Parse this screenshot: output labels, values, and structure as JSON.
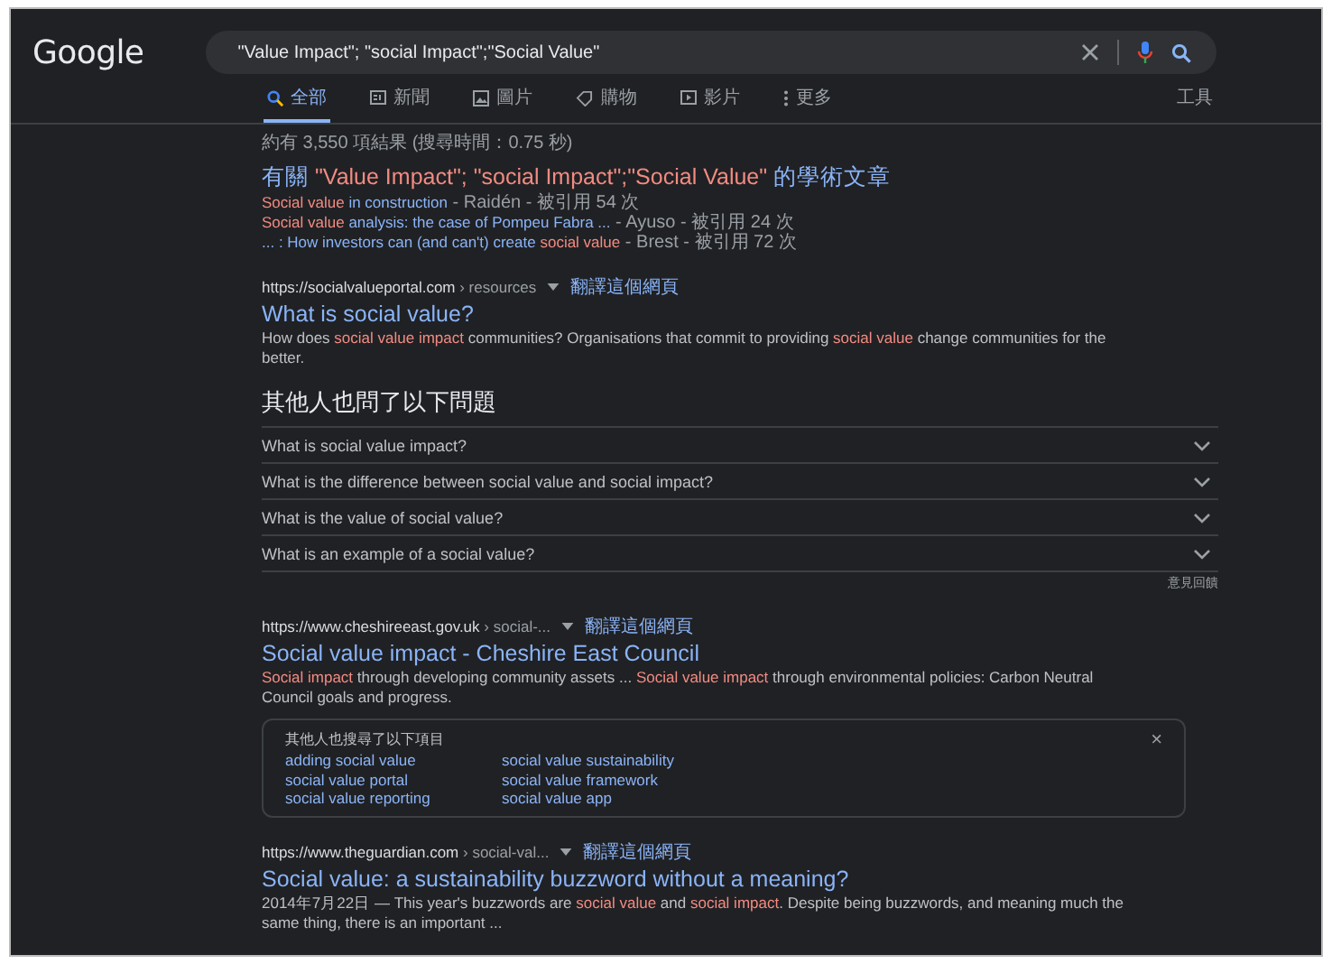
{
  "logo": "Google",
  "search": {
    "value": "\"Value Impact\"; \"social Impact\";\"Social Value\""
  },
  "tabs": [
    {
      "label": "全部",
      "kind": "search",
      "selected": true
    },
    {
      "label": "新聞",
      "kind": "news",
      "selected": false
    },
    {
      "label": "圖片",
      "kind": "images",
      "selected": false
    },
    {
      "label": "購物",
      "kind": "shopping",
      "selected": false
    },
    {
      "label": "影片",
      "kind": "videos",
      "selected": false
    },
    {
      "label": "更多",
      "kind": "more",
      "selected": false
    }
  ],
  "tools": "工具",
  "stats": "約有 3,550 項結果 (搜尋時間：0.75 秒)",
  "scholar": {
    "title": "有關 **\"Value Impact\"; \"social Impact\";\"Social Value\"** 的學術文章",
    "items": [
      {
        "title": "**Social value** in construction",
        "meta": " - Raidén - 被引用 54 次"
      },
      {
        "title": "**Social value** analysis: the case of Pompeu Fabra ...",
        "meta": " - Ayuso - 被引用 24 次"
      },
      {
        "title": "... : How investors can (and can't) create **social value**",
        "meta": " - Brest - 被引用 72 次"
      }
    ]
  },
  "results": [
    {
      "url": "https://socialvalueportal.com",
      "path": " › resources",
      "translate": "翻譯這個網頁",
      "title": "What is social value?",
      "snippet": "How does **social value impact** communities? Organisations that commit to providing **social value** change communities for the better."
    }
  ],
  "people_also_ask": {
    "heading": "其他人也問了以下問題",
    "questions": [
      {
        "text": "What is social value impact?",
        "expanded": false
      },
      {
        "text": "What is the difference between social value and social impact?",
        "expanded": false
      },
      {
        "text": "What is the value of social value?",
        "expanded": false
      },
      {
        "text": "What is an example of a social value?",
        "expanded": false
      }
    ],
    "feedback": "意見回饋"
  },
  "results_2": [
    {
      "url": "https://www.cheshireeast.gov.uk",
      "path": " › social-...",
      "translate": "翻譯這個網頁",
      "title": "Social value impact - Cheshire East Council",
      "snippet": "**Social impact** through developing community assets ... **Social value impact** through environmental policies: Carbon Neutral Council goals and progress."
    }
  ],
  "related": {
    "heading": "其他人也搜尋了以下項目",
    "close": "×",
    "links": [
      "adding social value",
      "social value sustainability",
      "social value portal",
      "social value framework",
      "social value reporting",
      "social value app"
    ]
  },
  "results_3": [
    {
      "url": "https://www.theguardian.com",
      "path": " › social-val...",
      "translate": "翻譯這個網頁",
      "title": "Social value: a sustainability buzzword without a meaning?",
      "snippet": "2014年7月22日 — This year's buzzwords are **social value** and **social impact**. Despite being buzzwords, and meaning much the same thing, there is an important ..."
    }
  ]
}
